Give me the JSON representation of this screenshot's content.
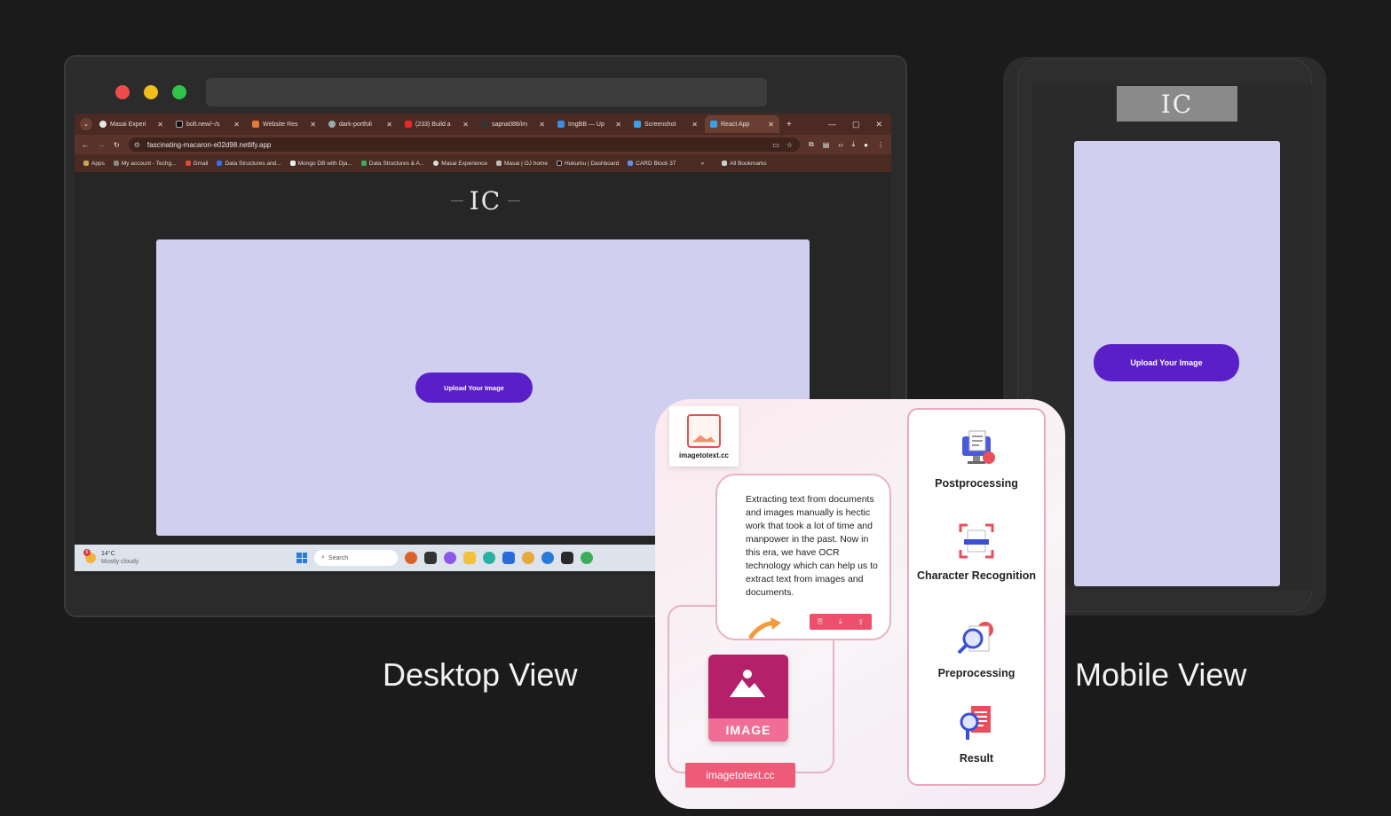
{
  "desktop": {
    "traffic_lights": [
      "#ee4b4b",
      "#f1bd1b",
      "#2fc34b"
    ],
    "browser": {
      "tabs": [
        {
          "label": "Masai Experi",
          "color": "#e6e6e6"
        },
        {
          "label": "bolt.new/~/s",
          "color": "#e6e6e6"
        },
        {
          "label": "Website Res",
          "color": "#e07a3a"
        },
        {
          "label": "dark-portfoli",
          "color": "#9aa"
        },
        {
          "label": "(233) Build a",
          "color": "#e62929"
        },
        {
          "label": "sapna088/im",
          "color": "#333"
        },
        {
          "label": "ImgBB — Up",
          "color": "#3a8ee6"
        },
        {
          "label": "Screenshot",
          "color": "#3aa0e6"
        },
        {
          "label": "React App",
          "color": "#3aa0e6"
        }
      ],
      "new_tab": "+",
      "window_controls": [
        "—",
        "▢",
        "✕"
      ],
      "url": "fascinating-macaron-e02d98.netlify.app",
      "bookmarks": [
        "Apps",
        "My account - Techg...",
        "Gmail",
        "Data Structures and...",
        "Mongo DB with Dja...",
        "Data Structures & A...",
        "Masai Experience",
        "Masai | OJ home",
        "Hukumu | Dashboard",
        "CARD Block 37"
      ],
      "all_bookmarks": "All Bookmarks",
      "more": "»"
    },
    "app": {
      "logo": "IC",
      "upload_label": "Upload Your Image"
    },
    "taskbar": {
      "temp": "14°C",
      "weather": "Mostly cloudy",
      "badge": "6",
      "search_placeholder": "Search"
    },
    "caption": "Desktop View"
  },
  "mobile": {
    "logo": "IC",
    "upload_label": "Upload Your Image",
    "caption": "Mobile View"
  },
  "ocr_card": {
    "brand": "imagetotext.cc",
    "description": "Extracting text from documents and images manually is hectic work that took a lot of time and manpower in the past. Now in this era, we have OCR technology which can help us to extract text from images and documents.",
    "image_label": "IMAGE",
    "url_label": "imagetotext.cc",
    "steps": [
      "Postprocessing",
      "Character Recognition",
      "Preprocessing",
      "Result"
    ],
    "accent": "#ee5a78"
  }
}
